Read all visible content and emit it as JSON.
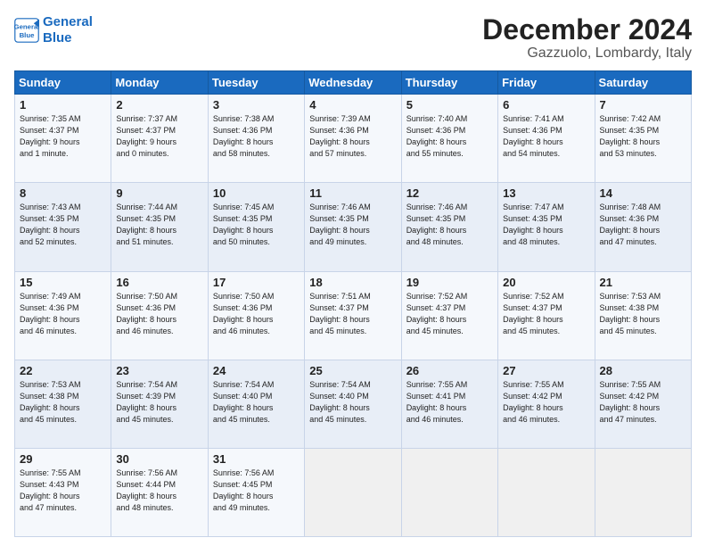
{
  "logo": {
    "line1": "General",
    "line2": "Blue"
  },
  "title": "December 2024",
  "subtitle": "Gazzuolo, Lombardy, Italy",
  "days_header": [
    "Sunday",
    "Monday",
    "Tuesday",
    "Wednesday",
    "Thursday",
    "Friday",
    "Saturday"
  ],
  "weeks": [
    [
      {
        "day": "1",
        "info": "Sunrise: 7:35 AM\nSunset: 4:37 PM\nDaylight: 9 hours\nand 1 minute."
      },
      {
        "day": "2",
        "info": "Sunrise: 7:37 AM\nSunset: 4:37 PM\nDaylight: 9 hours\nand 0 minutes."
      },
      {
        "day": "3",
        "info": "Sunrise: 7:38 AM\nSunset: 4:36 PM\nDaylight: 8 hours\nand 58 minutes."
      },
      {
        "day": "4",
        "info": "Sunrise: 7:39 AM\nSunset: 4:36 PM\nDaylight: 8 hours\nand 57 minutes."
      },
      {
        "day": "5",
        "info": "Sunrise: 7:40 AM\nSunset: 4:36 PM\nDaylight: 8 hours\nand 55 minutes."
      },
      {
        "day": "6",
        "info": "Sunrise: 7:41 AM\nSunset: 4:36 PM\nDaylight: 8 hours\nand 54 minutes."
      },
      {
        "day": "7",
        "info": "Sunrise: 7:42 AM\nSunset: 4:35 PM\nDaylight: 8 hours\nand 53 minutes."
      }
    ],
    [
      {
        "day": "8",
        "info": "Sunrise: 7:43 AM\nSunset: 4:35 PM\nDaylight: 8 hours\nand 52 minutes."
      },
      {
        "day": "9",
        "info": "Sunrise: 7:44 AM\nSunset: 4:35 PM\nDaylight: 8 hours\nand 51 minutes."
      },
      {
        "day": "10",
        "info": "Sunrise: 7:45 AM\nSunset: 4:35 PM\nDaylight: 8 hours\nand 50 minutes."
      },
      {
        "day": "11",
        "info": "Sunrise: 7:46 AM\nSunset: 4:35 PM\nDaylight: 8 hours\nand 49 minutes."
      },
      {
        "day": "12",
        "info": "Sunrise: 7:46 AM\nSunset: 4:35 PM\nDaylight: 8 hours\nand 48 minutes."
      },
      {
        "day": "13",
        "info": "Sunrise: 7:47 AM\nSunset: 4:35 PM\nDaylight: 8 hours\nand 48 minutes."
      },
      {
        "day": "14",
        "info": "Sunrise: 7:48 AM\nSunset: 4:36 PM\nDaylight: 8 hours\nand 47 minutes."
      }
    ],
    [
      {
        "day": "15",
        "info": "Sunrise: 7:49 AM\nSunset: 4:36 PM\nDaylight: 8 hours\nand 46 minutes."
      },
      {
        "day": "16",
        "info": "Sunrise: 7:50 AM\nSunset: 4:36 PM\nDaylight: 8 hours\nand 46 minutes."
      },
      {
        "day": "17",
        "info": "Sunrise: 7:50 AM\nSunset: 4:36 PM\nDaylight: 8 hours\nand 46 minutes."
      },
      {
        "day": "18",
        "info": "Sunrise: 7:51 AM\nSunset: 4:37 PM\nDaylight: 8 hours\nand 45 minutes."
      },
      {
        "day": "19",
        "info": "Sunrise: 7:52 AM\nSunset: 4:37 PM\nDaylight: 8 hours\nand 45 minutes."
      },
      {
        "day": "20",
        "info": "Sunrise: 7:52 AM\nSunset: 4:37 PM\nDaylight: 8 hours\nand 45 minutes."
      },
      {
        "day": "21",
        "info": "Sunrise: 7:53 AM\nSunset: 4:38 PM\nDaylight: 8 hours\nand 45 minutes."
      }
    ],
    [
      {
        "day": "22",
        "info": "Sunrise: 7:53 AM\nSunset: 4:38 PM\nDaylight: 8 hours\nand 45 minutes."
      },
      {
        "day": "23",
        "info": "Sunrise: 7:54 AM\nSunset: 4:39 PM\nDaylight: 8 hours\nand 45 minutes."
      },
      {
        "day": "24",
        "info": "Sunrise: 7:54 AM\nSunset: 4:40 PM\nDaylight: 8 hours\nand 45 minutes."
      },
      {
        "day": "25",
        "info": "Sunrise: 7:54 AM\nSunset: 4:40 PM\nDaylight: 8 hours\nand 45 minutes."
      },
      {
        "day": "26",
        "info": "Sunrise: 7:55 AM\nSunset: 4:41 PM\nDaylight: 8 hours\nand 46 minutes."
      },
      {
        "day": "27",
        "info": "Sunrise: 7:55 AM\nSunset: 4:42 PM\nDaylight: 8 hours\nand 46 minutes."
      },
      {
        "day": "28",
        "info": "Sunrise: 7:55 AM\nSunset: 4:42 PM\nDaylight: 8 hours\nand 47 minutes."
      }
    ],
    [
      {
        "day": "29",
        "info": "Sunrise: 7:55 AM\nSunset: 4:43 PM\nDaylight: 8 hours\nand 47 minutes."
      },
      {
        "day": "30",
        "info": "Sunrise: 7:56 AM\nSunset: 4:44 PM\nDaylight: 8 hours\nand 48 minutes."
      },
      {
        "day": "31",
        "info": "Sunrise: 7:56 AM\nSunset: 4:45 PM\nDaylight: 8 hours\nand 49 minutes."
      },
      null,
      null,
      null,
      null
    ]
  ]
}
